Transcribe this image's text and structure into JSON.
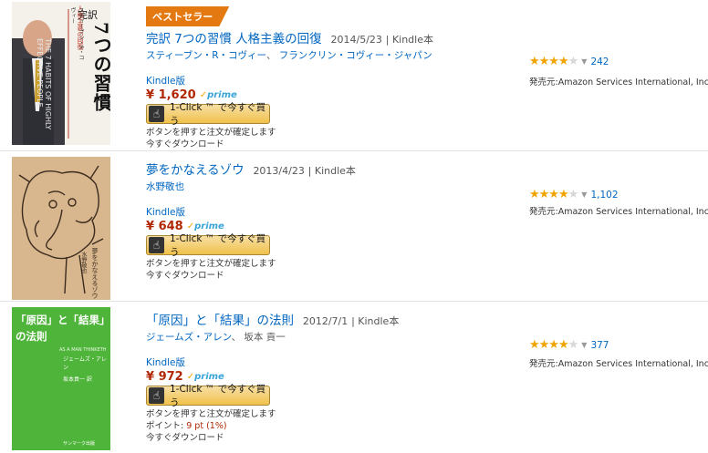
{
  "results": [
    {
      "badge": "ベストセラー",
      "title": "完訳 7つの習慣 人格主義の回復",
      "date": "2014/5/23",
      "type": "Kindle本",
      "authors": [
        {
          "name": "スティーブン・R・コヴィー",
          "sep": "、 "
        },
        {
          "name": "フランクリン・コヴィー・ジャパン",
          "sep": ""
        }
      ],
      "format": "Kindle版",
      "price": "¥ 1,620",
      "prime": "prime",
      "oneclick": "1-Click ™ で今すぐ買う",
      "note1": "ボタンを押すと注文が確定します",
      "note2": "今すぐダウンロード",
      "stars": 4.5,
      "review_count": "242",
      "seller": "発売元:Amazon Services International, Inc.",
      "cover": {
        "title_big": "7つの習慣",
        "top_label": "完訳",
        "sub": "人格主義の回復",
        "author_small": "スティーブン・R・コヴィー",
        "english": "THE 7 HABITS OF HIGHLY EFFECTIVE PEOPLE"
      }
    },
    {
      "title": "夢をかなえるゾウ",
      "date": "2013/4/23",
      "type": "Kindle本",
      "authors": [
        {
          "name": "水野敬也",
          "sep": ""
        }
      ],
      "format": "Kindle版",
      "price": "¥ 648",
      "prime": "prime",
      "oneclick": "1-Click ™ で今すぐ買う",
      "note1": "ボタンを押すと注文が確定します",
      "note2": "今すぐダウンロード",
      "stars": 4.5,
      "review_count": "1,102",
      "seller": "発売元:Amazon Services International, Inc.",
      "cover": {
        "title_vertical": "夢をかなえるゾウ",
        "author_vertical": "水野敬也"
      }
    },
    {
      "title": "「原因」と「結果」の法則",
      "date": "2012/7/1",
      "type": "Kindle本",
      "authors": [
        {
          "name": "ジェームズ・アレン",
          "sep": "、 "
        },
        {
          "name": "坂本 貢一",
          "sep": "",
          "plain": true
        }
      ],
      "format": "Kindle版",
      "price": "¥ 972",
      "prime": "prime",
      "oneclick": "1-Click ™ で今すぐ買う",
      "note1": "ボタンを押すと注文が確定します",
      "points_label": "ポイント:",
      "points_value": "9 pt",
      "points_pct": "(1%)",
      "note2": "今すぐダウンロード",
      "stars": 4,
      "review_count": "377",
      "seller": "発売元:Amazon Services International, Inc.",
      "cover": {
        "title_line1": "「原因」と「結果」",
        "title_line2": "の法則",
        "english": "AS A MAN THINKETH",
        "author": "ジェームズ・アレン",
        "translator": "坂本貢一 訳",
        "publisher": "サンマーク出版"
      }
    }
  ],
  "icons": {
    "oneclick": "hand-pointer-icon",
    "caret": "caret-down-icon",
    "star": "star-icon"
  },
  "colors": {
    "link": "#0066c0",
    "price": "#b12704",
    "badge": "#e47911",
    "star": "#f0a400"
  }
}
